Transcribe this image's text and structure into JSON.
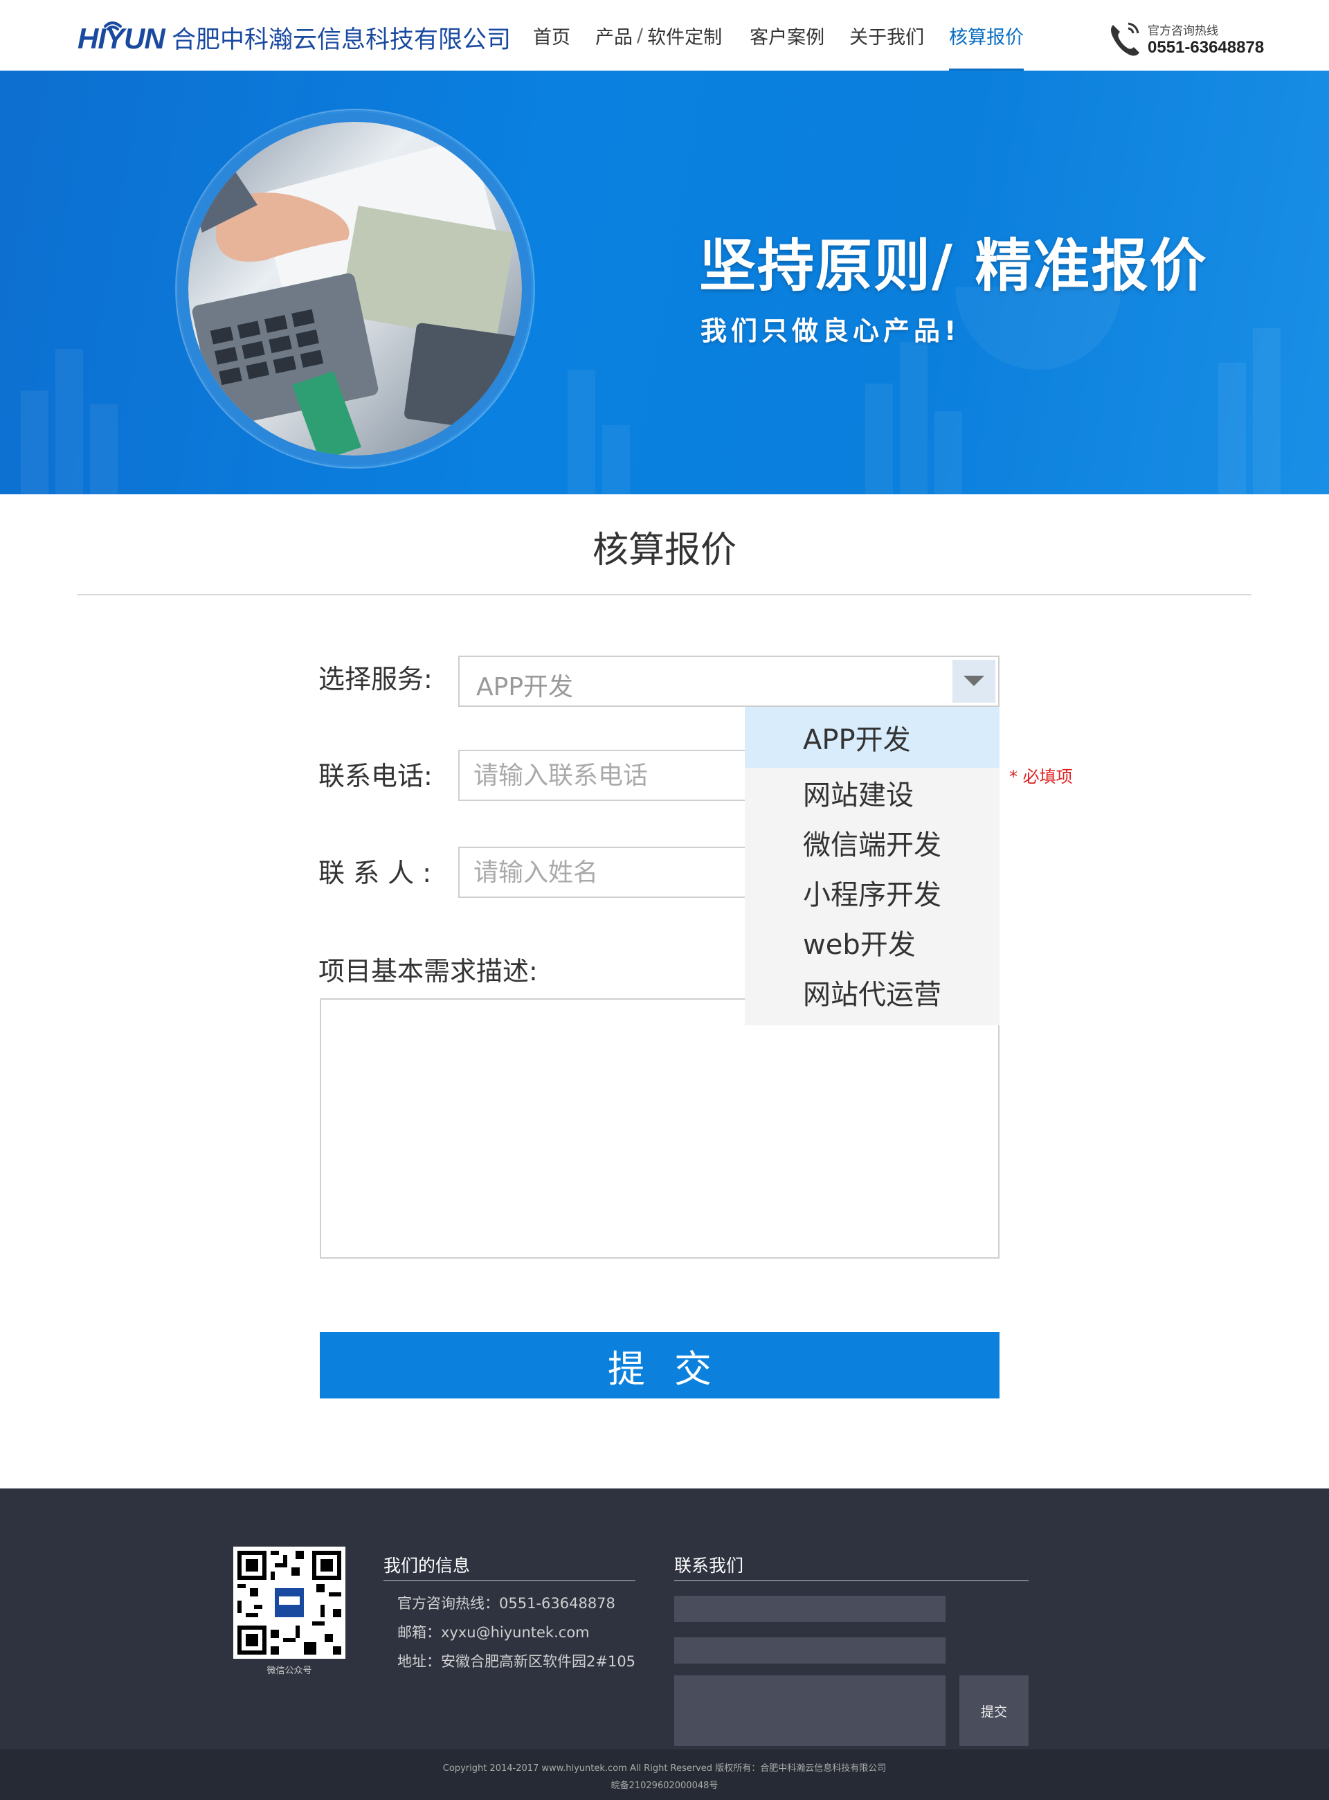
{
  "header": {
    "logo_text": "HIYUN",
    "company_name": "合肥中科瀚云信息科技有限公司",
    "nav": {
      "home": "首页",
      "products": "产品",
      "sep": "/",
      "software_custom": "软件定制",
      "cases": "客户案例",
      "about": "关于我们",
      "quote": "核算报价"
    },
    "hotline_label": "官方咨询热线",
    "hotline_number": "0551-63648878"
  },
  "banner": {
    "title": "坚持原则/ 精准报价",
    "subtitle": "我们只做良心产品!"
  },
  "page": {
    "title": "核算报价"
  },
  "form": {
    "service_label": "选择服务:",
    "service_selected": "APP开发",
    "service_options": [
      "APP开发",
      "网站建设",
      "微信端开发",
      "小程序开发",
      "web开发",
      "网站代运营"
    ],
    "phone_label": "联系电话:",
    "phone_placeholder": "请输入联系电话",
    "required_note": "* 必填项",
    "contact_label": "联 系 人 :",
    "contact_placeholder": "请输入姓名",
    "description_label": "项目基本需求描述:",
    "submit_label": "提交"
  },
  "footer": {
    "qr_caption": "微信公众号",
    "info_heading": "我们的信息",
    "hotline": "官方咨询热线：0551-63648878",
    "email": "邮箱：xyxu@hiyuntek.com",
    "address": "地址：安徽合肥高新区软件园2#105",
    "contact_heading": "联系我们",
    "contact_submit": "提交",
    "copyright": "Copyright 2014-2017 www.hiyuntek.com All Right Reserved 版权所有：合肥中科瀚云信息科技有限公司",
    "icp": "皖备21029602000048号"
  },
  "colors": {
    "brand": "#1a4aa0",
    "accent": "#0b81dd",
    "nav_active": "#0b6fc3",
    "required": "#e02020",
    "footer_bg": "#2f3340"
  }
}
